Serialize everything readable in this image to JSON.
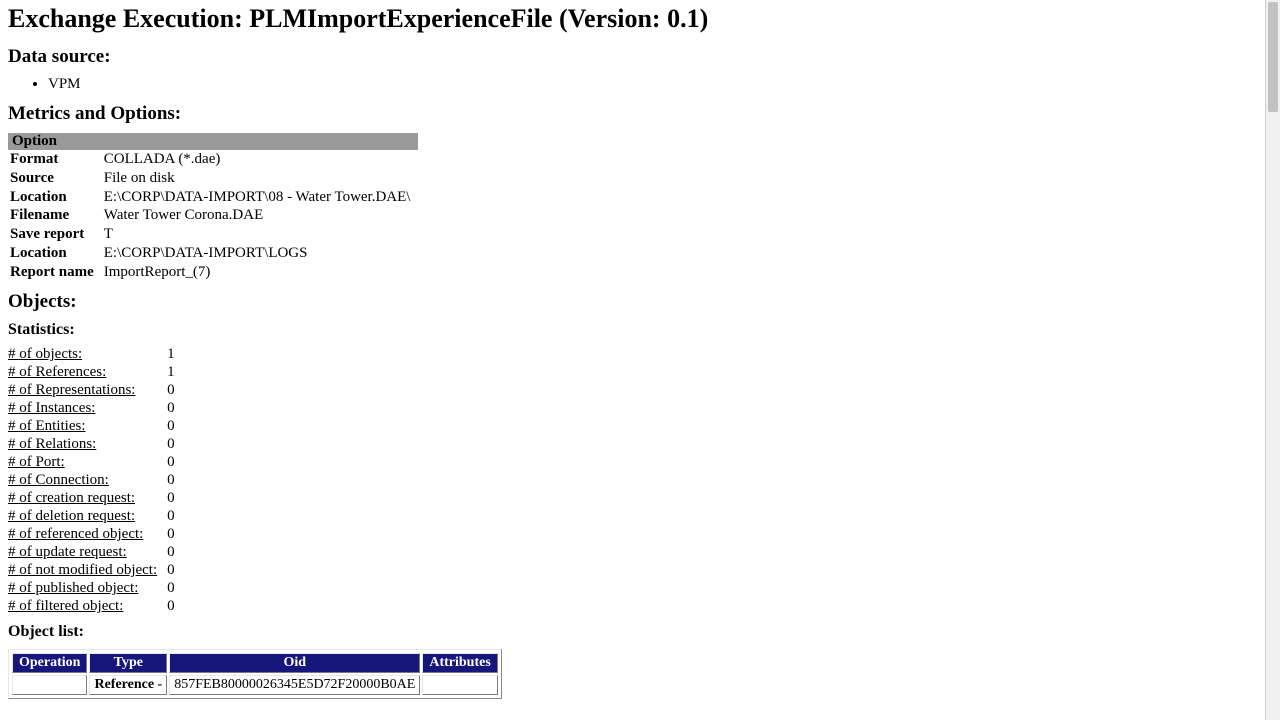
{
  "title": "Exchange Execution: PLMImportExperienceFile (Version: 0.1)",
  "sections": {
    "data_source": "Data source:",
    "metrics": "Metrics and Options:",
    "objects": "Objects:",
    "statistics": "Statistics:",
    "object_list": "Object list:"
  },
  "data_sources": [
    "VPM"
  ],
  "options_header": "Option",
  "options": [
    {
      "label": "Format",
      "value": "COLLADA (*.dae)"
    },
    {
      "label": "Source",
      "value": "File on disk"
    },
    {
      "label": "Location",
      "value": "E:\\CORP\\DATA-IMPORT\\08 - Water Tower.DAE\\"
    },
    {
      "label": "Filename",
      "value": "Water Tower Corona.DAE"
    },
    {
      "label": "Save report",
      "value": "T"
    },
    {
      "label": "Location",
      "value": "E:\\CORP\\DATA-IMPORT\\LOGS"
    },
    {
      "label": "Report name",
      "value": "ImportReport_(7)"
    }
  ],
  "statistics": [
    {
      "label": "# of objects:",
      "value": "1"
    },
    {
      "label": "# of References:",
      "value": "1"
    },
    {
      "label": "# of Representations:",
      "value": "0"
    },
    {
      "label": "# of Instances:",
      "value": "0"
    },
    {
      "label": "# of Entities:",
      "value": "0"
    },
    {
      "label": "# of Relations:",
      "value": "0"
    },
    {
      "label": "# of Port:",
      "value": "0"
    },
    {
      "label": "# of Connection:",
      "value": "0"
    },
    {
      "label": "# of creation request:",
      "value": "0"
    },
    {
      "label": "# of deletion request:",
      "value": "0"
    },
    {
      "label": "# of referenced object:",
      "value": "0"
    },
    {
      "label": "# of update request:",
      "value": "0"
    },
    {
      "label": "# of not modified object:",
      "value": "0"
    },
    {
      "label": "# of published object:",
      "value": "0"
    },
    {
      "label": "# of filtered object:",
      "value": "0"
    }
  ],
  "object_list": {
    "headers": [
      "Operation",
      "Type",
      "Oid",
      "Attributes"
    ],
    "rows": [
      {
        "operation": "",
        "type": "Reference -",
        "oid": "857FEB80000026345E5D72F20000B0AE",
        "attributes": ""
      }
    ]
  }
}
